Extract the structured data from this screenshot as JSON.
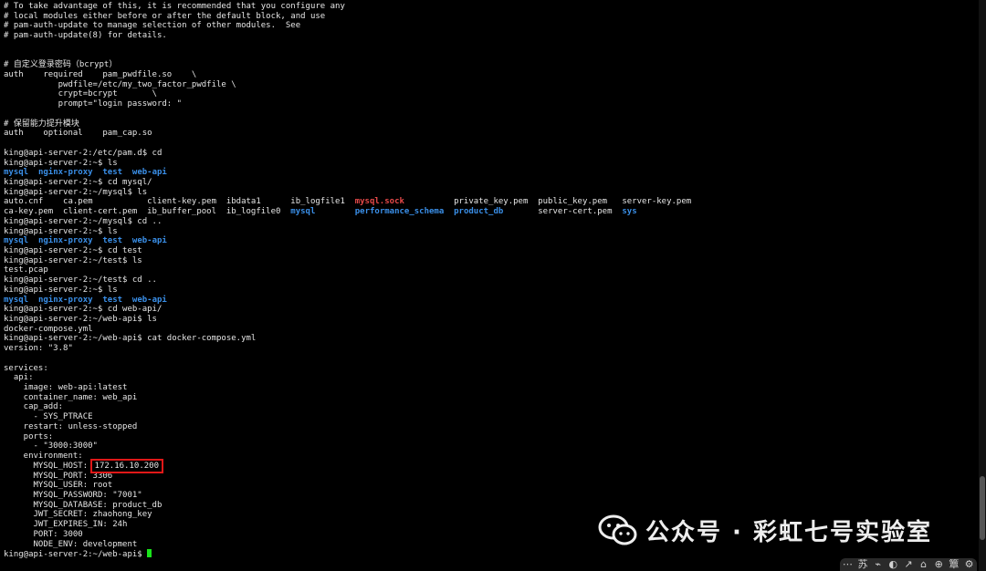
{
  "terminal": {
    "lines": [
      [
        {
          "t": "# To take advantage of this, it is recommended that you configure any",
          "c": "white"
        }
      ],
      [
        {
          "t": "# local modules either before or after the default block, and use",
          "c": "white"
        }
      ],
      [
        {
          "t": "# pam-auth-update to manage selection of other modules.  See",
          "c": "white"
        }
      ],
      [
        {
          "t": "# pam-auth-update(8) for details.",
          "c": "white"
        }
      ],
      [],
      [],
      [
        {
          "t": "# 自定义登录密码（bcrypt）",
          "c": "white"
        }
      ],
      [
        {
          "t": "auth    required    pam_pwdfile.so    \\",
          "c": "white"
        }
      ],
      [
        {
          "t": "           pwdfile=/etc/my_two_factor_pwdfile \\",
          "c": "white"
        }
      ],
      [
        {
          "t": "           crypt=bcrypt       \\",
          "c": "white"
        }
      ],
      [
        {
          "t": "           prompt=\"login password: \"",
          "c": "white"
        }
      ],
      [],
      [
        {
          "t": "# 保留能力提升模块",
          "c": "white"
        }
      ],
      [
        {
          "t": "auth    optional    pam_cap.so",
          "c": "white"
        }
      ],
      [],
      [
        {
          "t": "king@api-server-2:/etc/pam.d$ cd",
          "c": "white"
        }
      ],
      [
        {
          "t": "king@api-server-2:~$ ls",
          "c": "white"
        }
      ],
      [
        {
          "t": "mysql",
          "c": "blue"
        },
        {
          "t": "  ",
          "c": "white"
        },
        {
          "t": "nginx-proxy",
          "c": "blue"
        },
        {
          "t": "  ",
          "c": "white"
        },
        {
          "t": "test",
          "c": "blue"
        },
        {
          "t": "  ",
          "c": "white"
        },
        {
          "t": "web-api",
          "c": "blue"
        }
      ],
      [
        {
          "t": "king@api-server-2:~$ cd mysql/",
          "c": "white"
        }
      ],
      [
        {
          "t": "king@api-server-2:~/mysql$ ls",
          "c": "white"
        }
      ],
      [
        {
          "t": "auto.cnf    ca.pem           client-key.pem  ibdata1      ib_logfile1  ",
          "c": "white"
        },
        {
          "t": "mysql.sock",
          "c": "red"
        },
        {
          "t": "          private_key.pem  public_key.pem   server-key.pem",
          "c": "white"
        }
      ],
      [
        {
          "t": "ca-key.pem  client-cert.pem  ib_buffer_pool  ib_logfile0  ",
          "c": "white"
        },
        {
          "t": "mysql",
          "c": "blue"
        },
        {
          "t": "        ",
          "c": "white"
        },
        {
          "t": "performance_schema",
          "c": "blue"
        },
        {
          "t": "  ",
          "c": "white"
        },
        {
          "t": "product_db",
          "c": "blue"
        },
        {
          "t": "       server-cert.pem  ",
          "c": "white"
        },
        {
          "t": "sys",
          "c": "blue"
        }
      ],
      [
        {
          "t": "king@api-server-2:~/mysql$ cd ..",
          "c": "white"
        }
      ],
      [
        {
          "t": "king@api-server-2:~$ ls",
          "c": "white"
        }
      ],
      [
        {
          "t": "mysql",
          "c": "blue"
        },
        {
          "t": "  ",
          "c": "white"
        },
        {
          "t": "nginx-proxy",
          "c": "blue"
        },
        {
          "t": "  ",
          "c": "white"
        },
        {
          "t": "test",
          "c": "blue"
        },
        {
          "t": "  ",
          "c": "white"
        },
        {
          "t": "web-api",
          "c": "blue"
        }
      ],
      [
        {
          "t": "king@api-server-2:~$ cd test",
          "c": "white"
        }
      ],
      [
        {
          "t": "king@api-server-2:~/test$ ls",
          "c": "white"
        }
      ],
      [
        {
          "t": "test.pcap",
          "c": "white"
        }
      ],
      [
        {
          "t": "king@api-server-2:~/test$ cd ..",
          "c": "white"
        }
      ],
      [
        {
          "t": "king@api-server-2:~$ ls",
          "c": "white"
        }
      ],
      [
        {
          "t": "mysql",
          "c": "blue"
        },
        {
          "t": "  ",
          "c": "white"
        },
        {
          "t": "nginx-proxy",
          "c": "blue"
        },
        {
          "t": "  ",
          "c": "white"
        },
        {
          "t": "test",
          "c": "blue"
        },
        {
          "t": "  ",
          "c": "white"
        },
        {
          "t": "web-api",
          "c": "blue"
        }
      ],
      [
        {
          "t": "king@api-server-2:~$ cd web-api/",
          "c": "white"
        }
      ],
      [
        {
          "t": "king@api-server-2:~/web-api$ ls",
          "c": "white"
        }
      ],
      [
        {
          "t": "docker-compose.yml",
          "c": "white"
        }
      ],
      [
        {
          "t": "king@api-server-2:~/web-api$ cat docker-compose.yml",
          "c": "white"
        }
      ],
      [
        {
          "t": "version: \"3.8\"",
          "c": "white"
        }
      ],
      [],
      [
        {
          "t": "services:",
          "c": "white"
        }
      ],
      [
        {
          "t": "  api:",
          "c": "white"
        }
      ],
      [
        {
          "t": "    image: web-api:latest",
          "c": "white"
        }
      ],
      [
        {
          "t": "    container_name: web_api",
          "c": "white"
        }
      ],
      [
        {
          "t": "    cap_add:",
          "c": "white"
        }
      ],
      [
        {
          "t": "      - SYS_PTRACE",
          "c": "white"
        }
      ],
      [
        {
          "t": "    restart: unless-stopped",
          "c": "white"
        }
      ],
      [
        {
          "t": "    ports:",
          "c": "white"
        }
      ],
      [
        {
          "t": "      - \"3000:3000\"",
          "c": "white"
        }
      ],
      [
        {
          "t": "    environment:",
          "c": "white"
        }
      ],
      [
        {
          "t": "      MYSQL_HOST: ",
          "c": "white"
        },
        {
          "t": "172.16.10.200",
          "c": "white",
          "hl": true
        }
      ],
      [
        {
          "t": "      MYSQL_PORT: 3306",
          "c": "white"
        }
      ],
      [
        {
          "t": "      MYSQL_USER: root",
          "c": "white"
        }
      ],
      [
        {
          "t": "      MYSQL_PASSWORD: \"7001\"",
          "c": "white"
        }
      ],
      [
        {
          "t": "      MYSQL_DATABASE: product_db",
          "c": "white"
        }
      ],
      [
        {
          "t": "      JWT_SECRET: zhaohong_key",
          "c": "white"
        }
      ],
      [
        {
          "t": "      JWT_EXPIRES_IN: 24h",
          "c": "white"
        }
      ],
      [
        {
          "t": "      PORT: 3000",
          "c": "white"
        }
      ],
      [
        {
          "t": "      NODE_ENV: development",
          "c": "white"
        }
      ],
      [
        {
          "t": "king@api-server-2:~/web-api$ ",
          "c": "white",
          "cursor": true
        }
      ]
    ]
  },
  "watermark": {
    "text": "公众号 · 彩虹七号实验室",
    "icon": "wechat-icon"
  },
  "toolbar": {
    "items": [
      "⋯",
      "苏",
      "⌁",
      "◐",
      "↗",
      "⌂",
      "⊕",
      "簟",
      "⚙"
    ]
  },
  "colors": {
    "background": "#000000",
    "text": "#e6e6e6",
    "directory": "#3a8fe8",
    "socket": "#e84a4a",
    "cursor": "#19e31a",
    "highlight_box": "#e01818"
  }
}
